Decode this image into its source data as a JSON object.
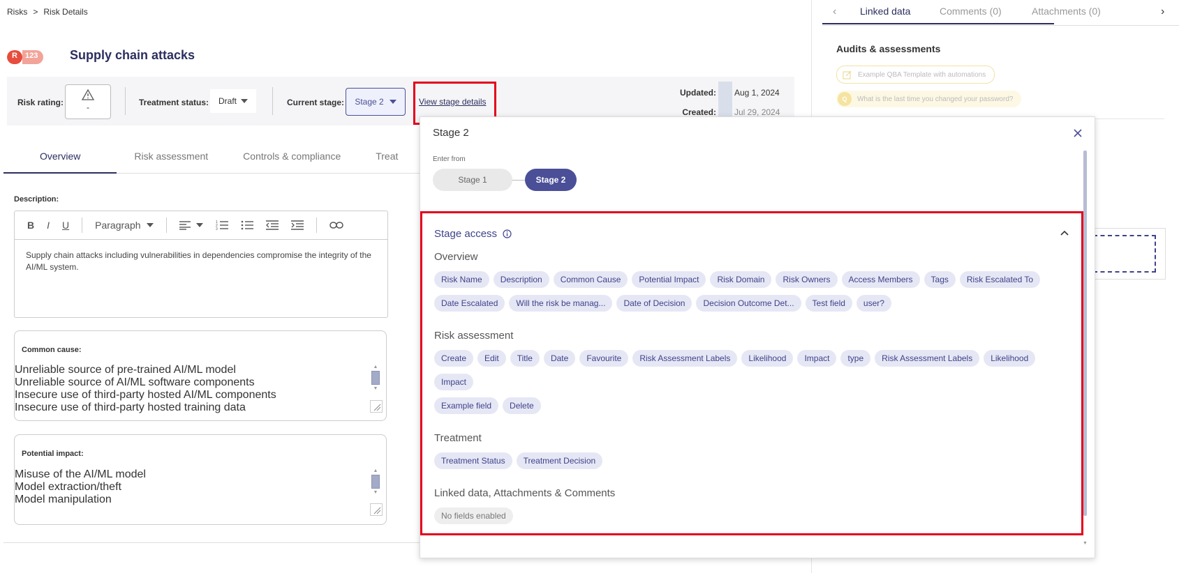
{
  "breadcrumb": {
    "root": "Risks",
    "sep": ">",
    "current": "Risk Details"
  },
  "risk": {
    "badge_letter": "R",
    "badge_number": "123",
    "title": "Supply chain attacks"
  },
  "bar": {
    "risk_rating_label": "Risk rating:",
    "risk_rating_value": "-",
    "treatment_status_label": "Treatment status:",
    "treatment_status_value": "Draft",
    "current_stage_label": "Current stage:",
    "current_stage_value": "Stage 2",
    "view_stage_link": "View stage details",
    "updated_label": "Updated:",
    "updated_value": "Aug 1, 2024",
    "created_label": "Created:",
    "created_value": "Jul 29, 2024"
  },
  "tabs": [
    "Overview",
    "Risk assessment",
    "Controls & compliance",
    "Treat"
  ],
  "description": {
    "label": "Description:",
    "toolbar": {
      "bold": "B",
      "italic": "I",
      "underline": "U",
      "paragraph": "Paragraph"
    },
    "text": "Supply chain attacks including vulnerabilities in dependencies compromise the integrity of the AI/ML system."
  },
  "common_cause": {
    "label": "Common cause:",
    "lines": [
      "Unreliable source of pre-trained AI/ML model",
      "Unreliable source of AI/ML software components",
      "Insecure use of third-party hosted AI/ML components",
      "Insecure use of third-party hosted training data"
    ]
  },
  "potential_impact": {
    "label": "Potential impact:",
    "lines": [
      "Misuse of the AI/ML model",
      "Model extraction/theft",
      "Model manipulation"
    ]
  },
  "right_panel": {
    "tabs": [
      "Linked data",
      "Comments (0)",
      "Attachments (0)"
    ],
    "audits_title": "Audits & assessments",
    "audit_items": [
      "Example QBA Template with automations",
      "What is the last time you changed your password?"
    ],
    "audit_avatar": "Q"
  },
  "modal": {
    "title": "Stage 2",
    "enter_from_label": "Enter from",
    "stages": [
      "Stage 1",
      "Stage 2"
    ],
    "stage_access_title": "Stage access",
    "groups": [
      {
        "title": "Overview",
        "chips": [
          "Risk Name",
          "Description",
          "Common Cause",
          "Potential Impact",
          "Risk Domain",
          "Risk Owners",
          "Access Members",
          "Tags",
          "Risk Escalated To",
          "Date Escalated",
          "Will the risk be manag...",
          "Date of Decision",
          "Decision Outcome Det...",
          "Test field",
          "user?"
        ]
      },
      {
        "title": "Risk assessment",
        "chips": [
          "Create",
          "Edit",
          "Title",
          "Date",
          "Favourite",
          "Risk Assessment Labels",
          "Likelihood",
          "Impact",
          "type",
          "Risk Assessment Labels",
          "Likelihood",
          "Impact",
          "Example field",
          "Delete"
        ]
      },
      {
        "title": "Treatment",
        "chips": [
          "Treatment Status",
          "Treatment Decision"
        ]
      },
      {
        "title": "Linked data, Attachments & Comments",
        "chips": [
          "No fields enabled"
        ],
        "empty": true
      }
    ]
  },
  "colors": {
    "accent": "#4b4f98",
    "highlight": "#e3001b",
    "chip_bg": "#e6e7f5",
    "badge": "#e74c3c"
  }
}
